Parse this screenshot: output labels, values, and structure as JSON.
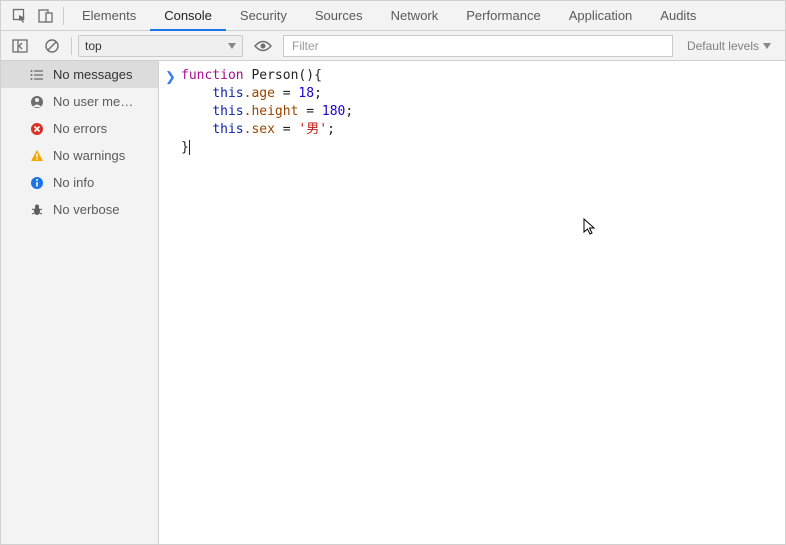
{
  "tabs": {
    "items": [
      {
        "label": "Elements",
        "active": false
      },
      {
        "label": "Console",
        "active": true
      },
      {
        "label": "Security",
        "active": false
      },
      {
        "label": "Sources",
        "active": false
      },
      {
        "label": "Network",
        "active": false
      },
      {
        "label": "Performance",
        "active": false
      },
      {
        "label": "Application",
        "active": false
      },
      {
        "label": "Audits",
        "active": false
      }
    ]
  },
  "toolbar": {
    "context": "top",
    "filter_placeholder": "Filter",
    "levels_label": "Default levels"
  },
  "sidebar": {
    "items": [
      {
        "label": "No messages",
        "icon": "list",
        "selected": true
      },
      {
        "label": "No user me…",
        "icon": "user",
        "selected": false
      },
      {
        "label": "No errors",
        "icon": "error",
        "selected": false
      },
      {
        "label": "No warnings",
        "icon": "warning",
        "selected": false
      },
      {
        "label": "No info",
        "icon": "info",
        "selected": false
      },
      {
        "label": "No verbose",
        "icon": "bug",
        "selected": false
      }
    ]
  },
  "console": {
    "code": {
      "fn_name": "Person",
      "lines": {
        "l1_kw": "function",
        "l1_rest": "(){",
        "this": "this",
        "prop_age": ".age",
        "eq": " = ",
        "val_age": "18",
        "prop_height": ".height",
        "val_height": "180",
        "prop_sex": ".sex",
        "val_sex": "'男'",
        "close": "}"
      }
    }
  }
}
